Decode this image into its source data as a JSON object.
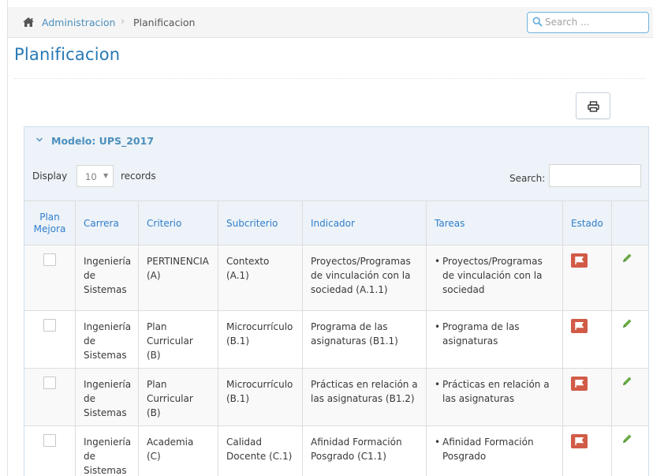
{
  "breadcrumb": {
    "root": "Administracion",
    "separator": "›",
    "current": "Planificacion"
  },
  "search": {
    "placeholder": "Search ..."
  },
  "page": {
    "title": "Planificacion"
  },
  "panel": {
    "model_title": "Modelo: UPS_2017"
  },
  "table_controls": {
    "display_label": "Display",
    "page_length": "10",
    "records_label": "records",
    "search_label": "Search:"
  },
  "table": {
    "headers": [
      "Plan Mejora",
      "Carrera",
      "Criterio",
      "Subcriterio",
      "Indicador",
      "Tareas",
      "Estado",
      ""
    ],
    "rows": [
      {
        "carrera": "Ingeniería de Sistemas",
        "criterio": "PERTINENCIA (A)",
        "subcriterio": "Contexto (A.1)",
        "indicador": "Proyectos/Programas de vinculación con la sociedad (A.1.1)",
        "tarea": "Proyectos/Programas de vinculación con la sociedad"
      },
      {
        "carrera": "Ingeniería de Sistemas",
        "criterio": "Plan Curricular (B)",
        "subcriterio": "Microcurrículo (B.1)",
        "indicador": "Programa de las asignaturas (B1.1)",
        "tarea": "Programa de las asignaturas"
      },
      {
        "carrera": "Ingeniería de Sistemas",
        "criterio": "Plan Curricular (B)",
        "subcriterio": "Microcurrículo (B.1)",
        "indicador": "Prácticas en relación a las asignaturas (B1.2)",
        "tarea": "Prácticas en relación a las asignaturas"
      },
      {
        "carrera": "Ingeniería de Sistemas",
        "criterio": "Academia (C)",
        "subcriterio": "Calidad Docente (C.1)",
        "indicador": "Afinidad Formación Posgrado (C1.1)",
        "tarea": "Afinidad Formación Posgrado"
      }
    ]
  },
  "icons": {
    "home": "home-icon",
    "search": "search-icon",
    "print": "print-icon",
    "toggle": "chevron-down-icon",
    "status": "flag-icon",
    "edit": "pencil-icon"
  },
  "colors": {
    "accent": "#2679b5",
    "link": "#4c8fbd",
    "header_text": "#307ecc",
    "status_flag": "#d15b47",
    "edit_icon": "#69aa46",
    "panel_header_bg": "#edf3f8"
  }
}
